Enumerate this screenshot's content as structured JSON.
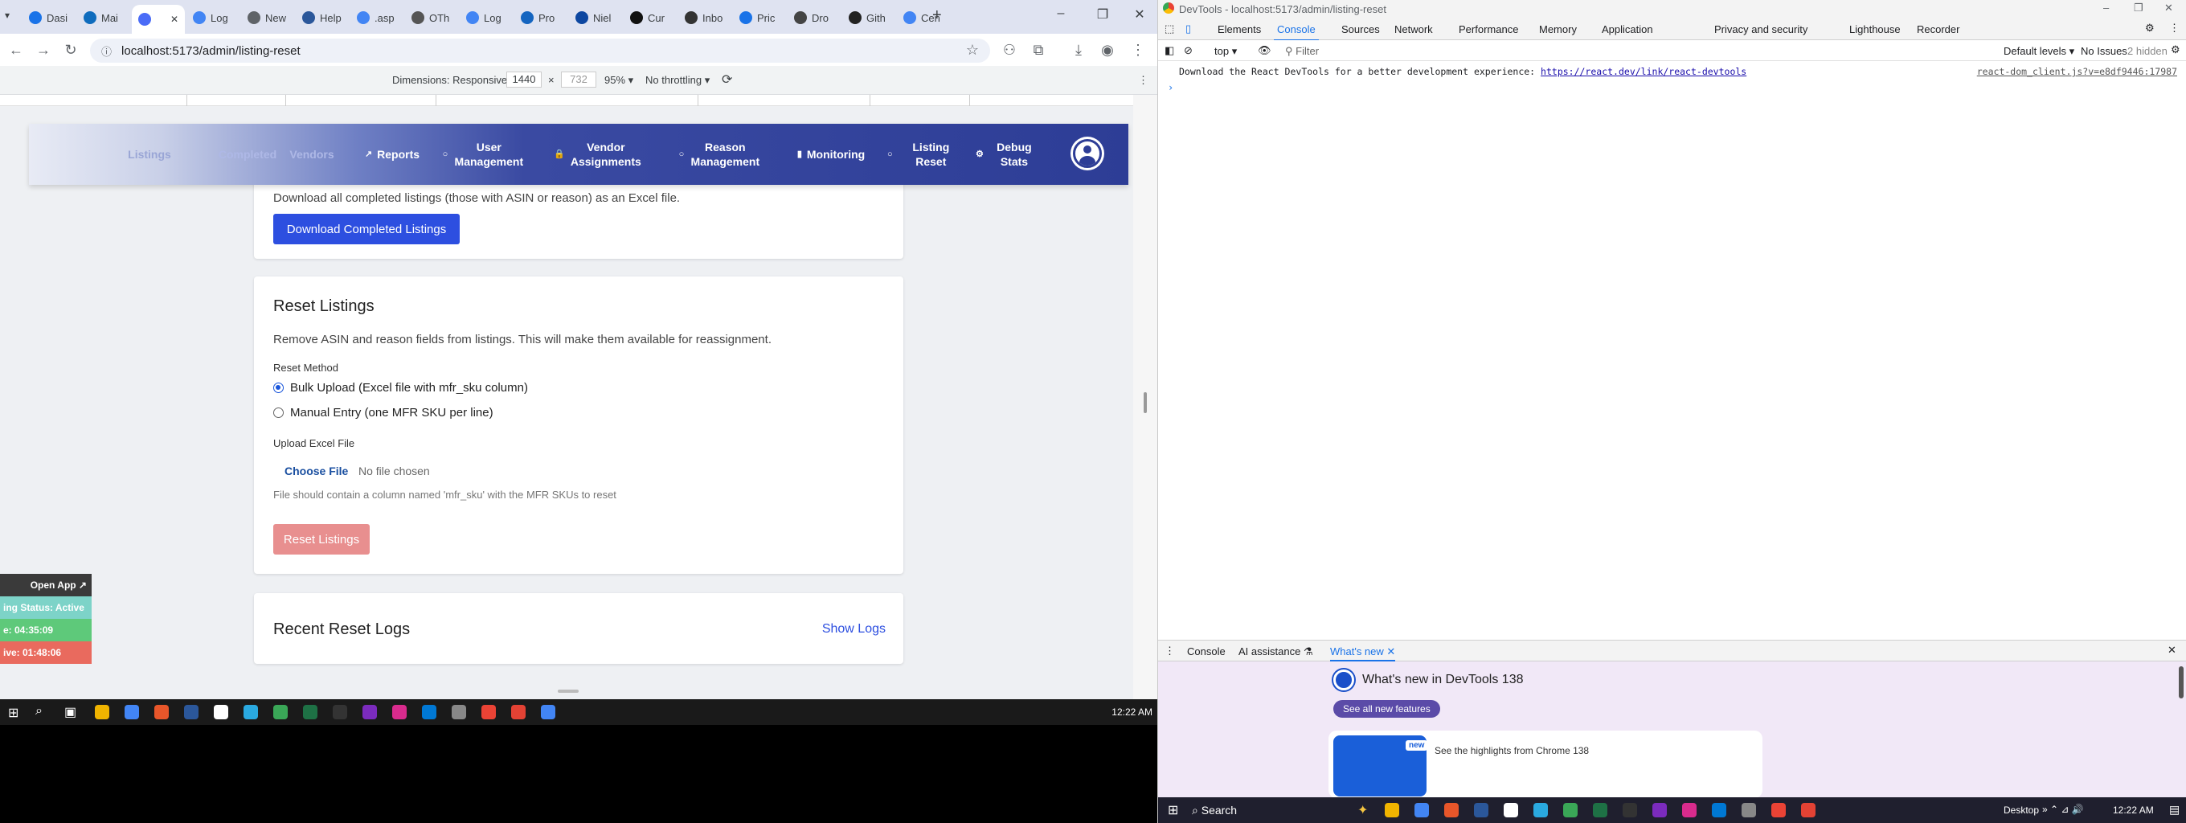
{
  "browser": {
    "tabs": [
      {
        "label": "Dasi",
        "color": "#1a73e8"
      },
      {
        "label": "Mai",
        "color": "#0f6cbd"
      },
      {
        "label": "",
        "color": "#4a6cf7",
        "active": true
      },
      {
        "label": "Log",
        "color": "#4285f4"
      },
      {
        "label": "New",
        "color": "#5f6368"
      },
      {
        "label": "Help",
        "color": "#2b579a"
      },
      {
        "label": ".asp",
        "color": "#4285f4"
      },
      {
        "label": "OTh",
        "color": "#555"
      },
      {
        "label": "Log",
        "color": "#4285f4"
      },
      {
        "label": "Pro",
        "color": "#1565c0"
      },
      {
        "label": "Niel",
        "color": "#0d47a1"
      },
      {
        "label": "Cur",
        "color": "#111"
      },
      {
        "label": "Inbo",
        "color": "#333"
      },
      {
        "label": "Pric",
        "color": "#1a73e8"
      },
      {
        "label": "Dro",
        "color": "#444"
      },
      {
        "label": "Gith",
        "color": "#222"
      },
      {
        "label": "Cen",
        "color": "#4285f4"
      }
    ],
    "url": "localhost:5173/admin/listing-reset",
    "device_toolbar": {
      "dimensions_label": "Dimensions: Responsive",
      "width": "1440",
      "height": "732",
      "zoom": "95%",
      "throttling": "No throttling"
    }
  },
  "app": {
    "nav": [
      {
        "label": "Listings"
      },
      {
        "label": "Completed"
      },
      {
        "label": "Vendors"
      },
      {
        "label": "Reports",
        "icon": "trend-icon"
      },
      {
        "label": "User Management",
        "icon": "circle-icon"
      },
      {
        "label": "Vendor Assignments",
        "icon": "lock-icon"
      },
      {
        "label": "Reason Management",
        "icon": "circle-icon"
      },
      {
        "label": "Monitoring",
        "icon": "chart-icon"
      },
      {
        "label": "Listing Reset",
        "icon": "circle-icon"
      },
      {
        "label": "Debug Stats",
        "icon": "gear-icon"
      }
    ],
    "download_card": {
      "description": "Download all completed listings (those with ASIN or reason) as an Excel file.",
      "button": "Download Completed Listings"
    },
    "reset_card": {
      "title": "Reset Listings",
      "description": "Remove ASIN and reason fields from listings. This will make them available for reassignment.",
      "method_label": "Reset Method",
      "options": [
        "Bulk Upload (Excel file with mfr_sku column)",
        "Manual Entry (one MFR SKU per line)"
      ],
      "selected_option": 0,
      "upload_label": "Upload Excel File",
      "choose_file": "Choose File",
      "no_file": "No file chosen",
      "hint": "File should contain a column named 'mfr_sku' with the MFR SKUs to reset",
      "reset_button": "Reset Listings"
    },
    "logs_card": {
      "title": "Recent Reset Logs",
      "toggle": "Show Logs"
    }
  },
  "widget": {
    "open_app": "Open App ↗",
    "status": "ing Status: Active",
    "time1": "e: 04:35:09",
    "time2": "ive: 01:48:06"
  },
  "taskbar_left": {
    "time": "12:22 AM"
  },
  "devtools": {
    "window_title": "DevTools - localhost:5173/admin/listing-reset",
    "tabs": [
      "Elements",
      "Console",
      "Sources",
      "Network",
      "Performance",
      "Memory",
      "Application",
      "Privacy and security",
      "Lighthouse",
      "Recorder"
    ],
    "active_tab": "Console",
    "context": "top",
    "filter_placeholder": "Filter",
    "levels": "Default levels",
    "issues": "No Issues",
    "hidden": "2 hidden",
    "console_message": "Download the React DevTools for a better development experience: ",
    "console_link": "https://react.dev/link/react-devtools",
    "console_source": "react-dom_client.js?v=e8df9446:17987",
    "drawer_tabs": [
      "Console",
      "AI assistance",
      "What's new"
    ],
    "whats_new_title": "What's new in DevTools 138",
    "see_all": "See all new features",
    "highlights": "See the highlights from Chrome 138",
    "new_badge": "new"
  },
  "taskbar_right": {
    "search": "Search",
    "desktop": "Desktop",
    "time": "12:22 AM"
  }
}
